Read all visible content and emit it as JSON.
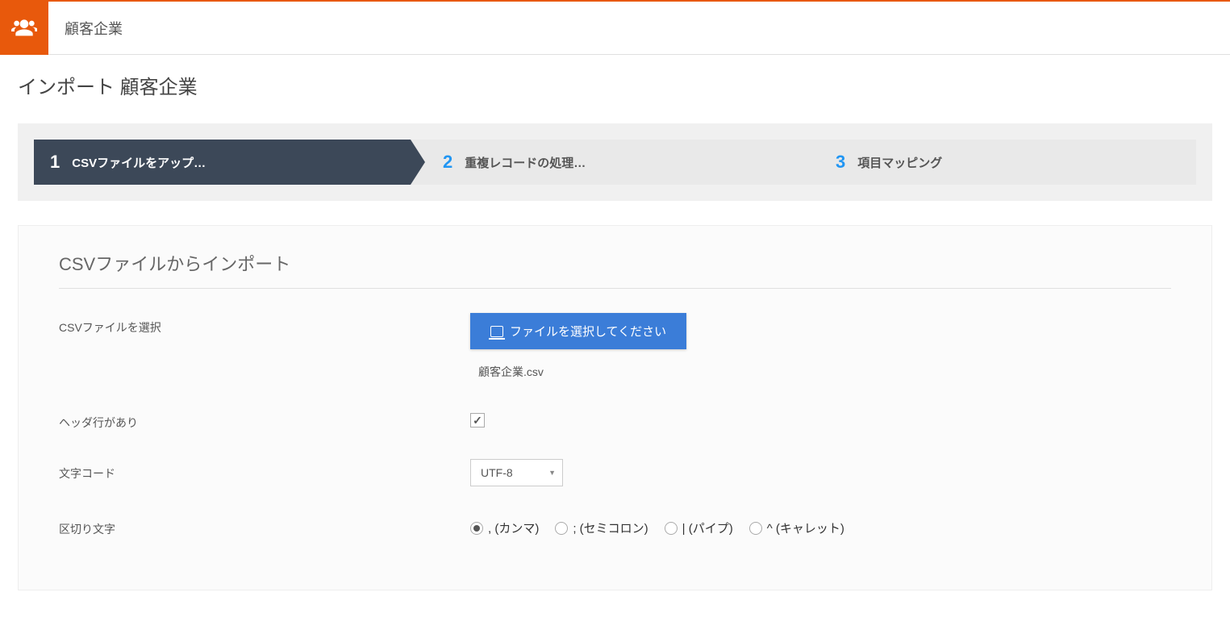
{
  "header": {
    "title": "顧客企業"
  },
  "page": {
    "title": "インポート 顧客企業"
  },
  "steps": [
    {
      "num": "1",
      "label": "CSVファイルをアップ…",
      "active": true
    },
    {
      "num": "2",
      "label": "重複レコードの処理…",
      "active": false
    },
    {
      "num": "3",
      "label": "項目マッピング",
      "active": false
    }
  ],
  "form": {
    "section_title": "CSVファイルからインポート",
    "file_select": {
      "label": "CSVファイルを選択",
      "button": "ファイルを選択してください",
      "filename": "顧客企業.csv"
    },
    "has_header": {
      "label": "ヘッダ行があり",
      "checked": true
    },
    "encoding": {
      "label": "文字コード",
      "value": "UTF-8"
    },
    "delimiter": {
      "label": "区切り文字",
      "options": [
        {
          "label": ", (カンマ)",
          "selected": true
        },
        {
          "label": "; (セミコロン)",
          "selected": false
        },
        {
          "label": "| (パイプ)",
          "selected": false
        },
        {
          "label": "^ (キャレット)",
          "selected": false
        }
      ]
    }
  }
}
